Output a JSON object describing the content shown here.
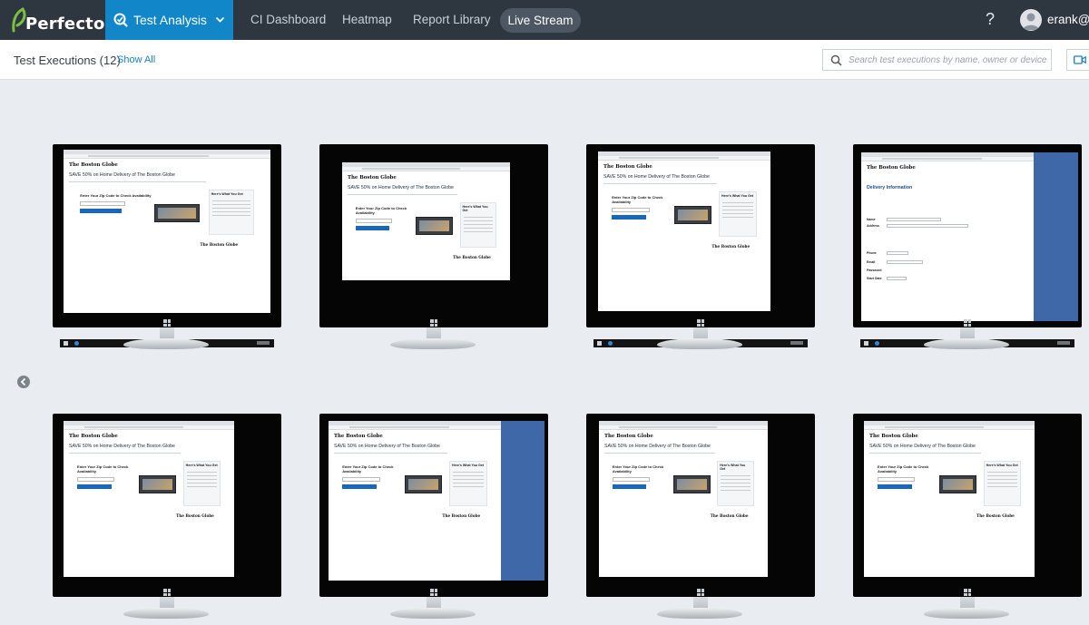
{
  "topbar": {
    "logo_text": "Perfecto",
    "product_label": "Test Analysis",
    "nav": [
      {
        "label": "CI Dashboard"
      },
      {
        "label": "Heatmap"
      },
      {
        "label": "Report Library"
      },
      {
        "label": "Live Stream"
      }
    ],
    "help_label": "?",
    "username": "erank@p"
  },
  "subheader": {
    "title": "Test Executions (12)",
    "show_all": "Show All",
    "search_placeholder": "Search test executions by name, owner or device"
  },
  "monitor_preview": {
    "masthead": "The Boston Globe",
    "headline": "SAVE 50% on Home Delivery of The Boston Globe",
    "zip_prompt": "Enter Your Zip Code to Check Availability",
    "sidebar_title": "Here's What You Get",
    "form_title": "Delivery Information",
    "form_name": "Name",
    "form_address": "Address",
    "form_phone": "Phone",
    "form_email": "Email",
    "form_password": "Password",
    "form_start": "Start Date"
  },
  "colors": {
    "topbar": "#2e3640",
    "accent": "#1186c9",
    "link": "#1a7fc4"
  }
}
